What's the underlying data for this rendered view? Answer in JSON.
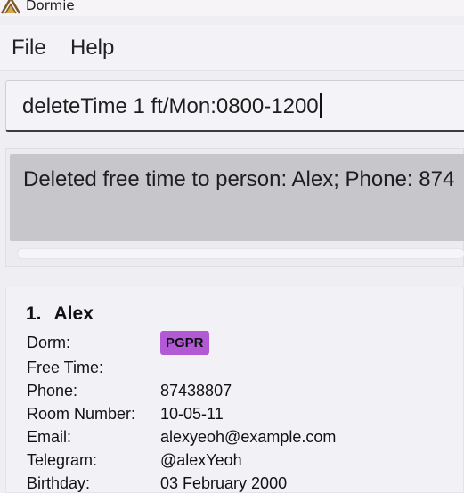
{
  "window": {
    "title": "Dormie",
    "icon": "dormie-app-icon"
  },
  "menu": {
    "items": [
      "File",
      "Help"
    ]
  },
  "command_box": {
    "value": "deleteTime 1 ft/Mon:0800-1200"
  },
  "result_display": {
    "text": "Deleted free time to person: Alex; Phone: 874"
  },
  "person_list": {
    "persons": [
      {
        "index": "1.",
        "name": "Alex",
        "tags": [
          "PGPR"
        ],
        "fields": [
          {
            "label": "Dorm:",
            "value": ""
          },
          {
            "label": "Free Time:",
            "value": ""
          },
          {
            "label": "Phone:",
            "value": "87438807"
          },
          {
            "label": "Room Number:",
            "value": "10-05-11"
          },
          {
            "label": "Email:",
            "value": "alexyeoh@example.com"
          },
          {
            "label": "Telegram:",
            "value": "@alexYeoh"
          },
          {
            "label": "Birthday:",
            "value": "03 February 2000"
          }
        ]
      }
    ]
  },
  "colors": {
    "tag": "#b25ad6",
    "result_bg": "#c6c6cb",
    "background": "#eeeef3"
  }
}
